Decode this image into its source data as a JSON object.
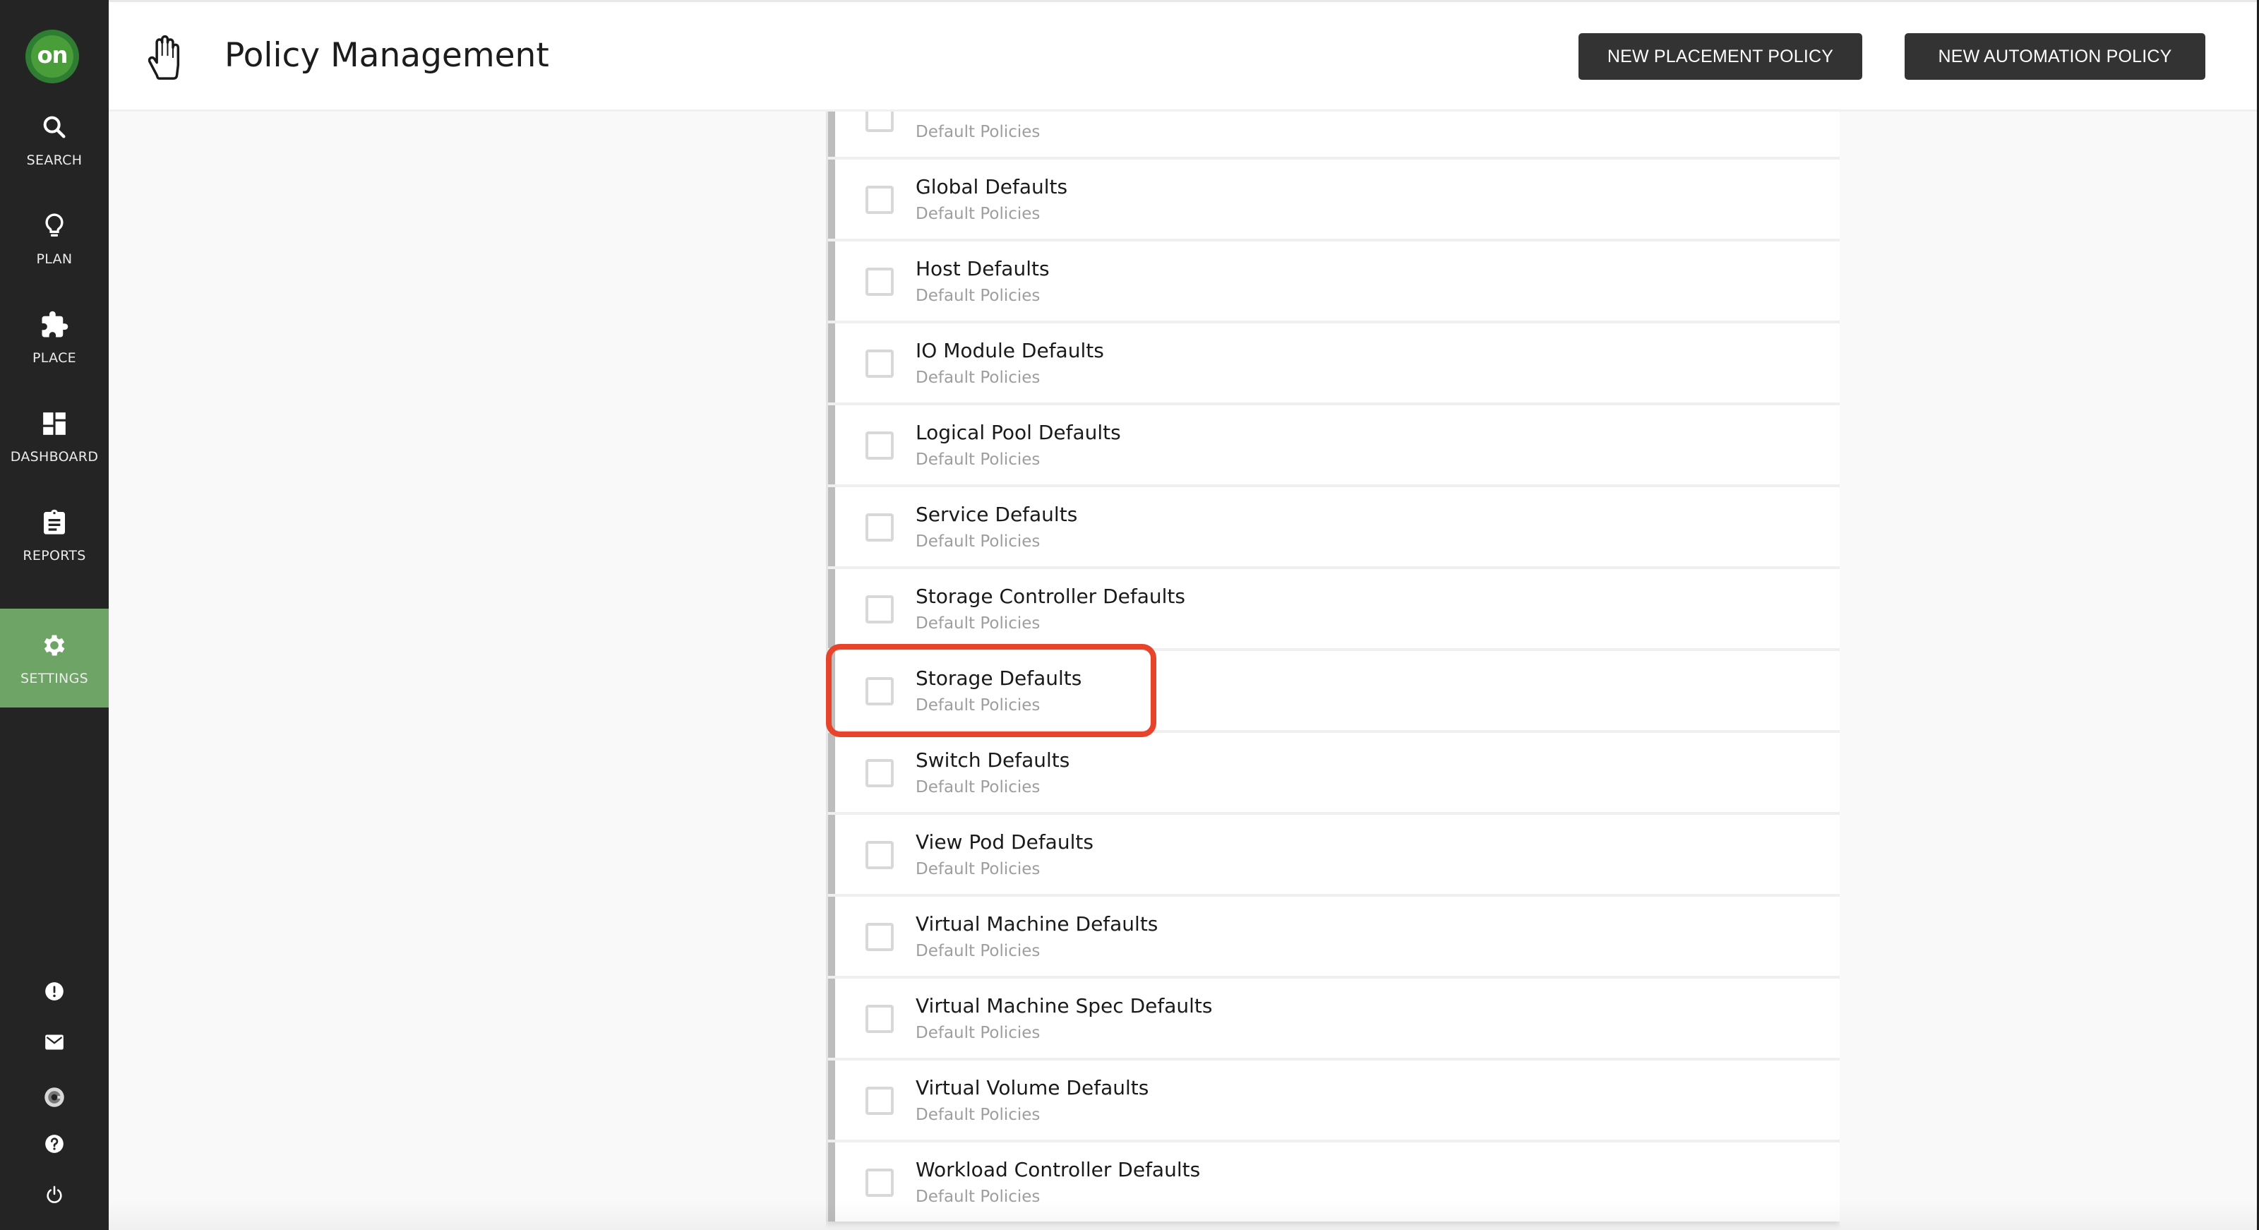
{
  "sidebar": {
    "logo_text": "on",
    "nav": [
      {
        "id": "search",
        "label": "SEARCH",
        "icon": "search-icon",
        "active": false
      },
      {
        "id": "plan",
        "label": "PLAN",
        "icon": "lightbulb-icon",
        "active": false
      },
      {
        "id": "place",
        "label": "PLACE",
        "icon": "puzzle-icon",
        "active": false
      },
      {
        "id": "dashboard",
        "label": "DASHBOARD",
        "icon": "dashboard-icon",
        "active": false
      },
      {
        "id": "reports",
        "label": "REPORTS",
        "icon": "clipboard-icon",
        "active": false
      },
      {
        "id": "settings",
        "label": "SETTINGS",
        "icon": "gear-icon",
        "active": true
      }
    ],
    "bottom_icons": [
      "alert-icon",
      "mail-icon",
      "g-logo-icon",
      "help-icon",
      "power-icon"
    ],
    "active_color": "#6ea466"
  },
  "header": {
    "title": "Policy Management",
    "title_icon": "hand-icon",
    "buttons": {
      "new_placement": "NEW PLACEMENT POLICY",
      "new_automation": "NEW AUTOMATION POLICY"
    }
  },
  "policies": {
    "rows": [
      {
        "title": "",
        "subtitle": "Default Policies",
        "checked": false,
        "clipped": true
      },
      {
        "title": "Global Defaults",
        "subtitle": "Default Policies",
        "checked": false
      },
      {
        "title": "Host Defaults",
        "subtitle": "Default Policies",
        "checked": false
      },
      {
        "title": "IO Module Defaults",
        "subtitle": "Default Policies",
        "checked": false
      },
      {
        "title": "Logical Pool Defaults",
        "subtitle": "Default Policies",
        "checked": false
      },
      {
        "title": "Service Defaults",
        "subtitle": "Default Policies",
        "checked": false
      },
      {
        "title": "Storage Controller Defaults",
        "subtitle": "Default Policies",
        "checked": false
      },
      {
        "title": "Storage Defaults",
        "subtitle": "Default Policies",
        "checked": false,
        "highlighted": true
      },
      {
        "title": "Switch Defaults",
        "subtitle": "Default Policies",
        "checked": false
      },
      {
        "title": "View Pod Defaults",
        "subtitle": "Default Policies",
        "checked": false
      },
      {
        "title": "Virtual Machine Defaults",
        "subtitle": "Default Policies",
        "checked": false
      },
      {
        "title": "Virtual Machine Spec Defaults",
        "subtitle": "Default Policies",
        "checked": false
      },
      {
        "title": "Virtual Volume Defaults",
        "subtitle": "Default Policies",
        "checked": false
      },
      {
        "title": "Workload Controller Defaults",
        "subtitle": "Default Policies",
        "checked": false
      }
    ],
    "highlight_color": "#e8432b"
  }
}
